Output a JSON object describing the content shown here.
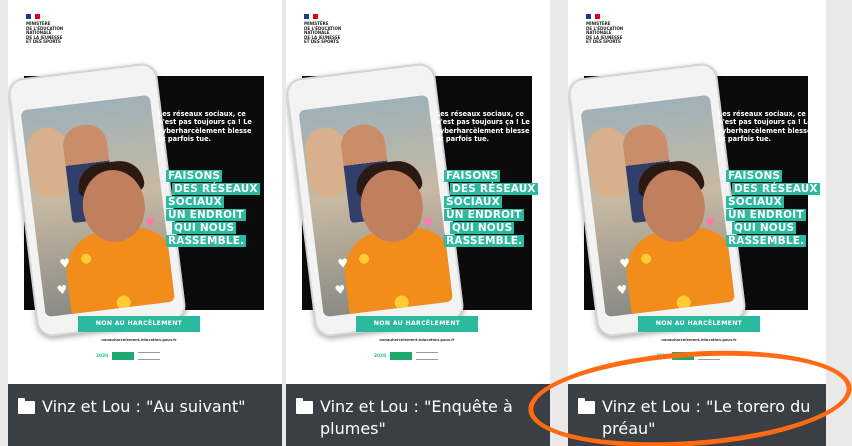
{
  "poster": {
    "logo_text": "MINISTÈRE\nDE L'ÉDUCATION\nNATIONALE\nDE LA JEUNESSE\nET DES SPORTS",
    "intro_text": "Les réseaux sociaux, ce n'est pas toujours ça ! Le cyberharcèlement blesse et parfois tue.",
    "slogan_lines": [
      "FAISONS",
      "DES RÉSEAUX",
      "SOCIAUX",
      "UN ENDROIT",
      "QUI NOUS",
      "RASSEMBLE."
    ],
    "cta": "NON AU HARCÈLEMENT",
    "cta_link": "nonauharcelement.education.gouv.fr",
    "year": "2020"
  },
  "cards": [
    {
      "caption": "Vinz et Lou : \"Au suivant\""
    },
    {
      "caption": "Vinz et Lou : \"Enquête à plumes\""
    },
    {
      "caption": "Vinz et Lou : \"Le torero du préau\""
    }
  ],
  "colors": {
    "accent": "#2bb9a0",
    "caption_bg": "#3b3e42",
    "annotation": "#ff6a13"
  }
}
